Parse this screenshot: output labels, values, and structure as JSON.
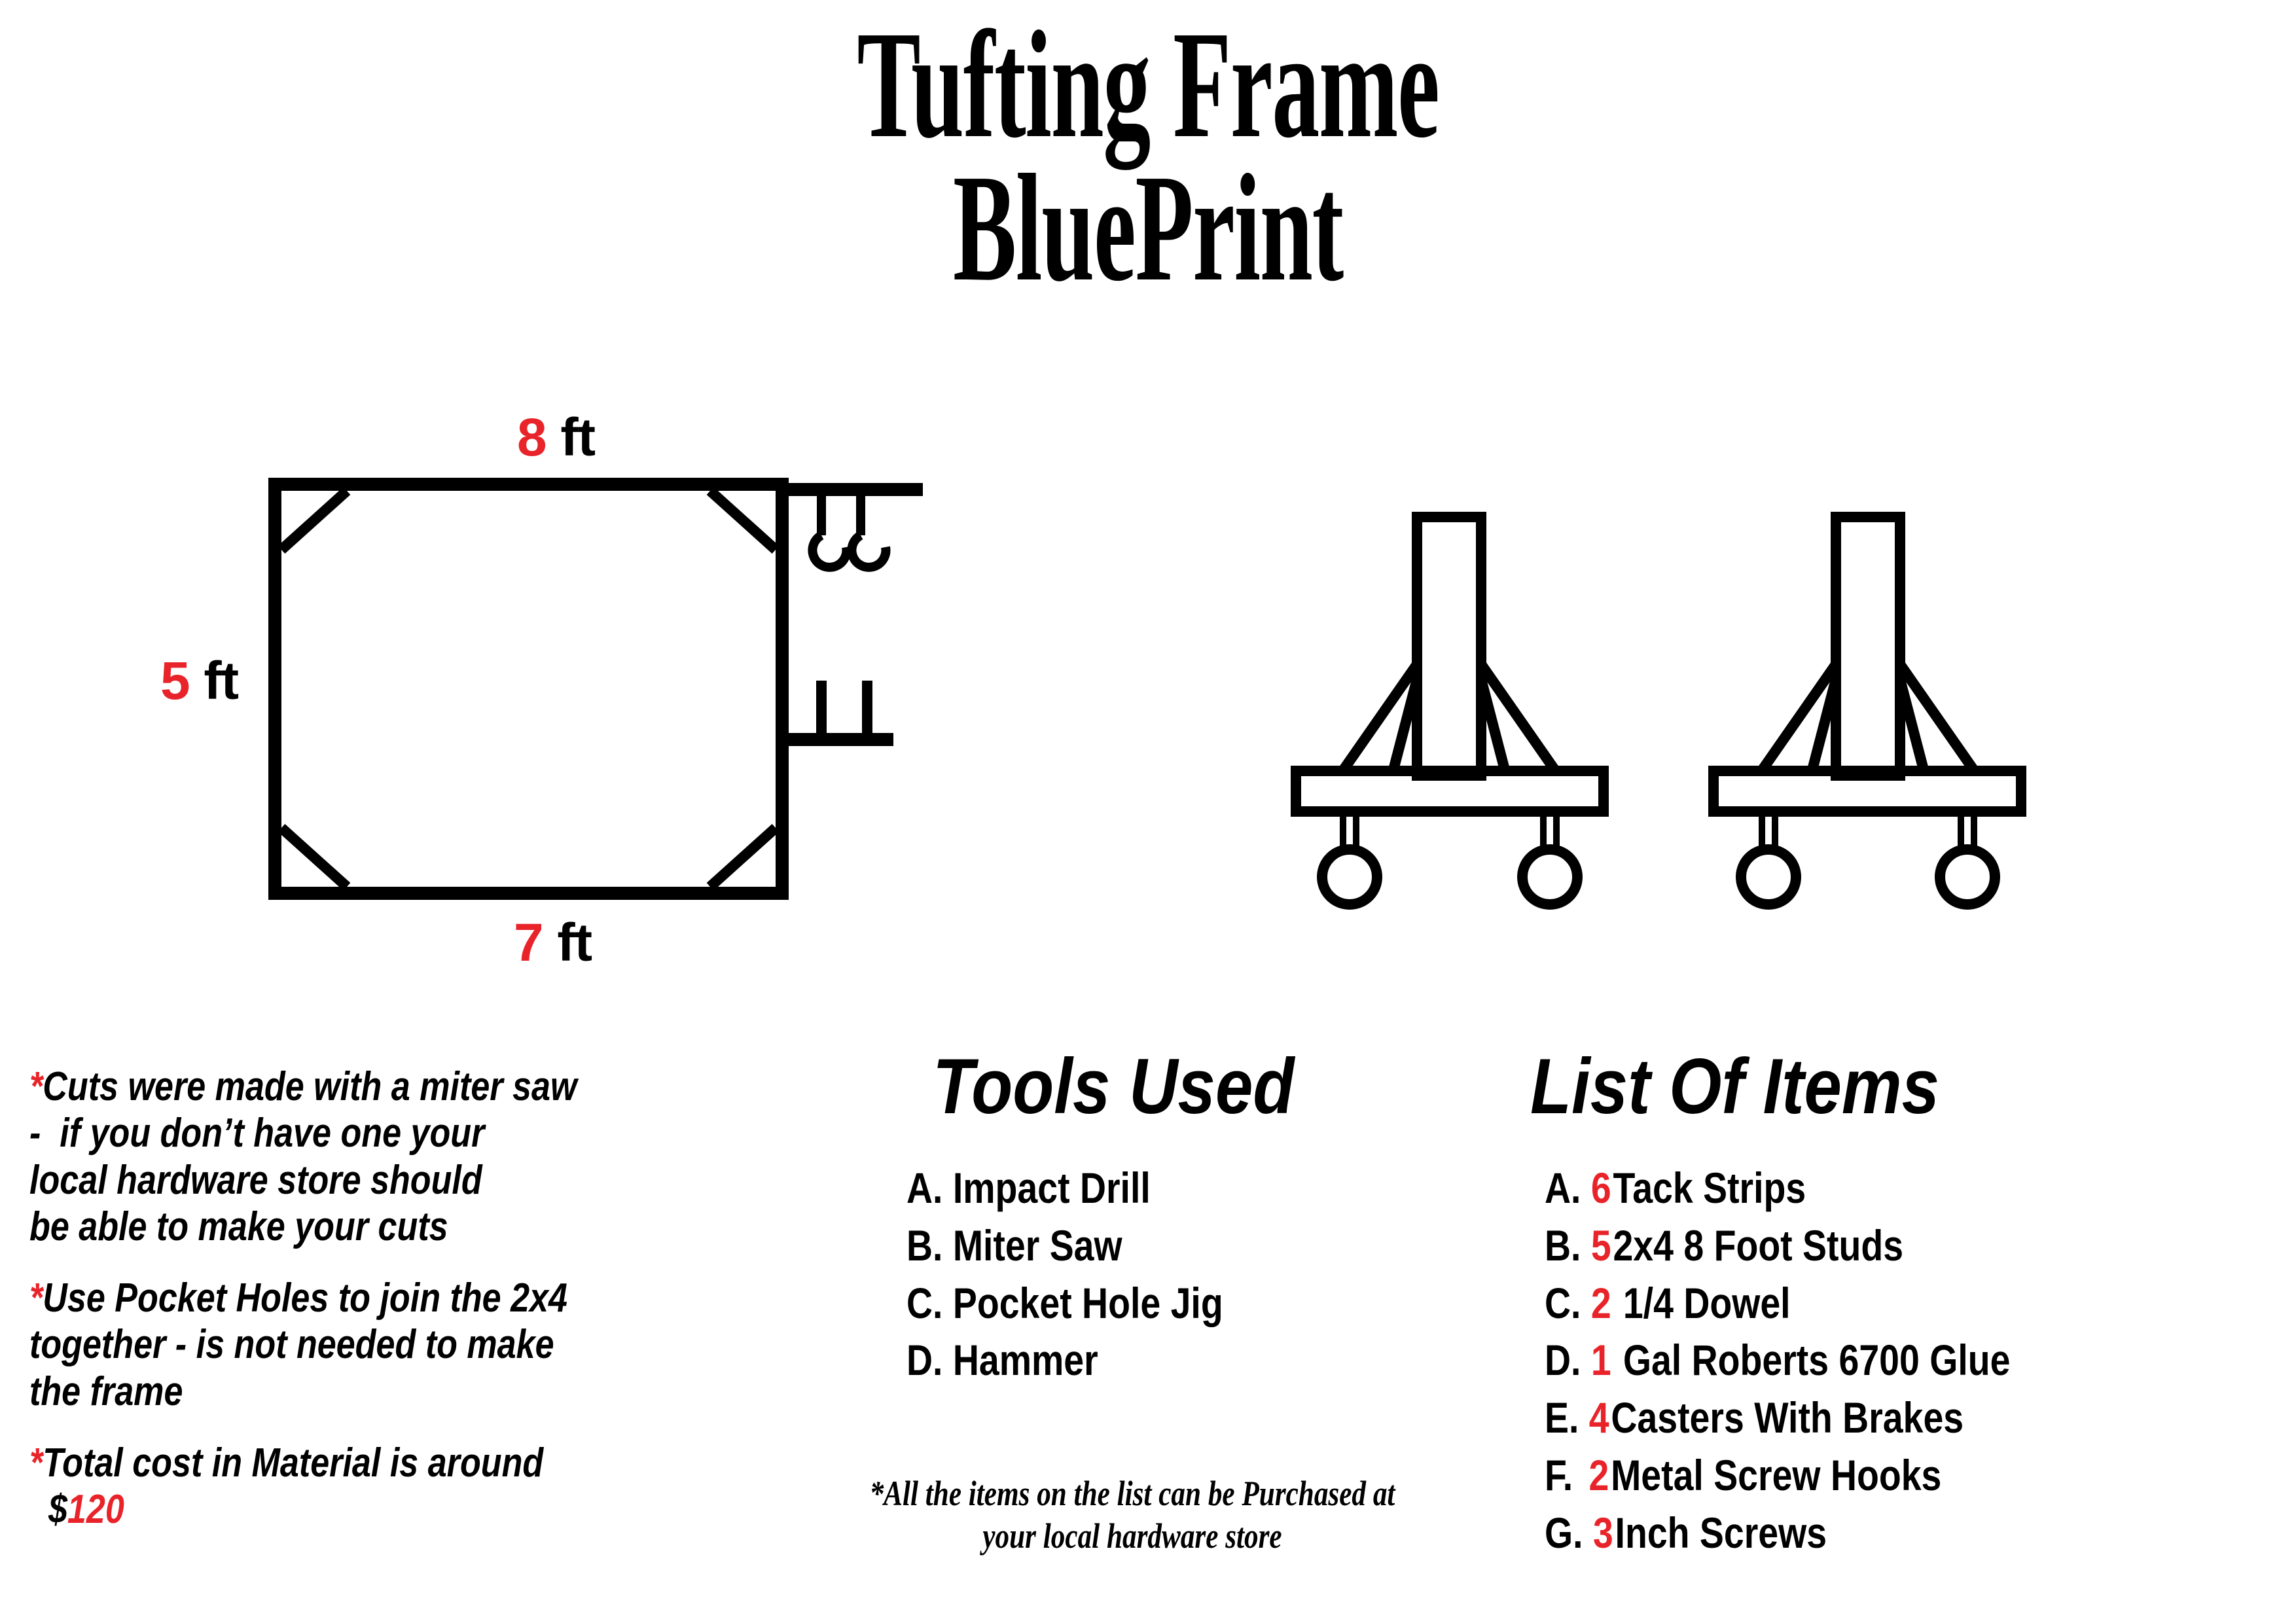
{
  "title": {
    "line1": "Tufting Frame",
    "line2": "BluePrint"
  },
  "colors": {
    "accent_red": "#E8242A",
    "ink_black": "#000000",
    "background": "#FFFFFF"
  },
  "frame_diagram": {
    "name": "tufting-frame-front-view",
    "dimensions": {
      "top": {
        "value": "8",
        "unit": "ft"
      },
      "left": {
        "value": "5",
        "unit": "ft"
      },
      "bottom": {
        "value": "7",
        "unit": "ft"
      }
    },
    "features": {
      "corner_braces": 4,
      "hooks": 2,
      "side_posts": 2
    }
  },
  "stands": {
    "name": "leg-stand-with-casters",
    "count": 2,
    "casters_per_stand": 2,
    "braces_per_stand": 2
  },
  "notes": [
    {
      "star": "*",
      "text": "Cuts were made with a miter saw\n-  if you don’t have one your\nlocal hardware store should\nbe able to make your cuts"
    },
    {
      "star": "*",
      "text": "Use Pocket Holes to join the 2x4\ntogether - is not needed to make\nthe frame"
    }
  ],
  "cost_note": {
    "star": "*",
    "text": "Total cost in Material is around",
    "currency": "$",
    "amount": "120"
  },
  "tools": {
    "heading": "Tools Used",
    "items": [
      {
        "label": "A.",
        "name": "Impact Drill"
      },
      {
        "label": "B.",
        "name": "Miter Saw"
      },
      {
        "label": "C.",
        "name": "Pocket Hole Jig"
      },
      {
        "label": "D.",
        "name": "Hammer"
      }
    ]
  },
  "items_list": {
    "heading": "List Of Items",
    "items": [
      {
        "label": "A.",
        "qty": "6",
        "name": "Tack Strips"
      },
      {
        "label": "B.",
        "qty": "5",
        "name": "2x4 8 Foot Studs"
      },
      {
        "label": "C.",
        "qty": "2",
        "name": " 1/4 Dowel"
      },
      {
        "label": "D.",
        "qty": "1",
        "name": "  Gal Roberts 6700 Glue"
      },
      {
        "label": "E.",
        "qty": "4",
        "name": "Casters With Brakes"
      },
      {
        "label": "F.",
        "qty": "2",
        "name": "Metal Screw Hooks"
      },
      {
        "label": "G.",
        "qty": "3",
        "name": "Inch Screws"
      }
    ]
  },
  "footnote": {
    "line1": "*All the items on the list can be Purchased at",
    "line2": "your local hardware store"
  }
}
